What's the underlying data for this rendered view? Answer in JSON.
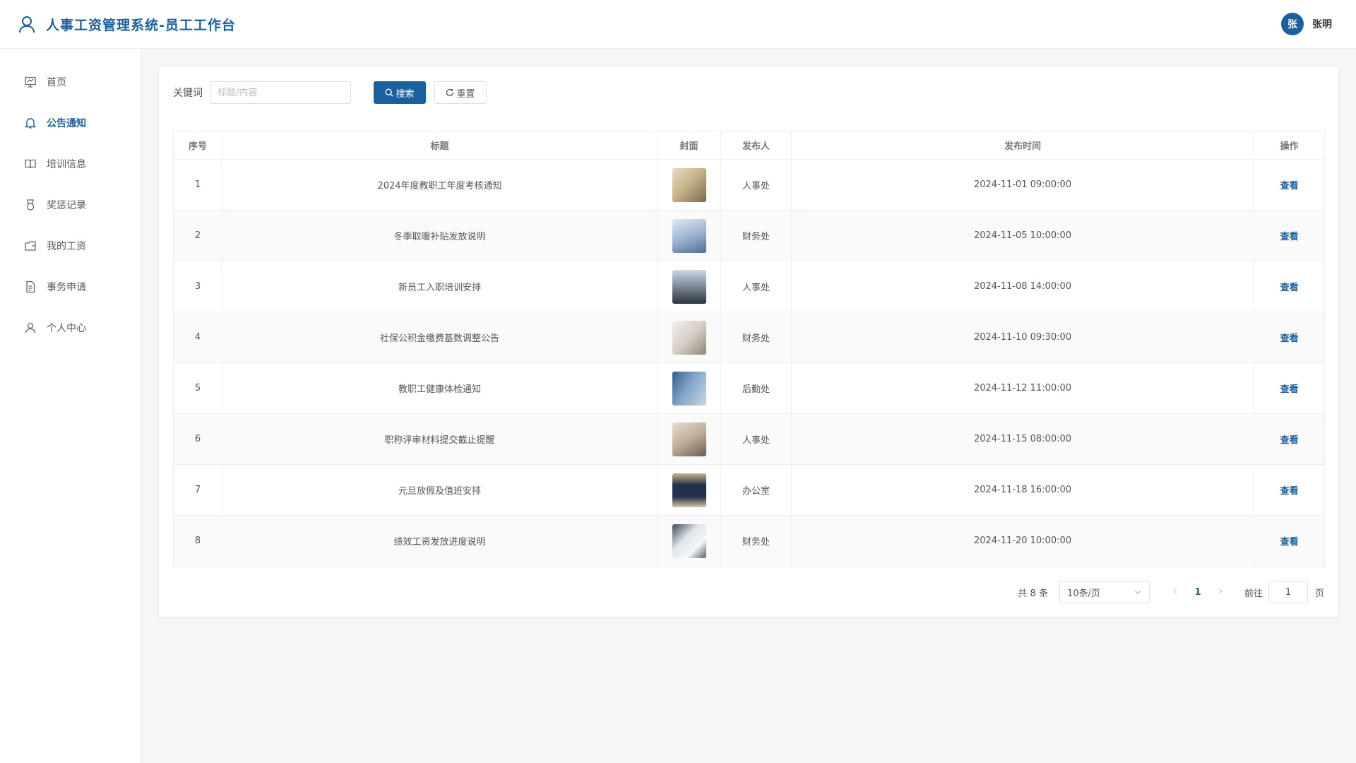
{
  "header": {
    "title": "人事工资管理系统-员工工作台",
    "avatar_initial": "张",
    "user_name": "张明"
  },
  "sidebar": {
    "items": [
      {
        "label": "首页",
        "icon": "presentation-icon"
      },
      {
        "label": "公告通知",
        "icon": "bell-icon",
        "active": true
      },
      {
        "label": "培训信息",
        "icon": "book-icon"
      },
      {
        "label": "奖惩记录",
        "icon": "medal-icon"
      },
      {
        "label": "我的工资",
        "icon": "wallet-icon"
      },
      {
        "label": "事务申请",
        "icon": "document-icon"
      },
      {
        "label": "个人中心",
        "icon": "user-icon"
      }
    ]
  },
  "search": {
    "label": "关键词",
    "placeholder": "标题/内容",
    "value": "",
    "search_label": "搜索",
    "reset_label": "重置"
  },
  "table": {
    "headers": [
      "序号",
      "标题",
      "封面",
      "发布人",
      "发布时间",
      "操作"
    ],
    "action_label": "查看",
    "rows": [
      {
        "no": "1",
        "title": "2024年度教职工年度考核通知",
        "publisher": "人事处",
        "time": "2024-11-01 09:00:00"
      },
      {
        "no": "2",
        "title": "冬季取暖补贴发放说明",
        "publisher": "财务处",
        "time": "2024-11-05 10:00:00"
      },
      {
        "no": "3",
        "title": "新员工入职培训安排",
        "publisher": "人事处",
        "time": "2024-11-08 14:00:00"
      },
      {
        "no": "4",
        "title": "社保公积金缴费基数调整公告",
        "publisher": "财务处",
        "time": "2024-11-10 09:30:00"
      },
      {
        "no": "5",
        "title": "教职工健康体检通知",
        "publisher": "后勤处",
        "time": "2024-11-12 11:00:00"
      },
      {
        "no": "6",
        "title": "职称评审材料提交截止提醒",
        "publisher": "人事处",
        "time": "2024-11-15 08:00:00"
      },
      {
        "no": "7",
        "title": "元旦放假及值班安排",
        "publisher": "办公室",
        "time": "2024-11-18 16:00:00"
      },
      {
        "no": "8",
        "title": "绩效工资发放进度说明",
        "publisher": "财务处",
        "time": "2024-11-20 10:00:00"
      }
    ]
  },
  "pagination": {
    "total": "共 8 条",
    "page_size": "10条/页",
    "current_page": "1",
    "goto_label": "前往",
    "goto_value": "1",
    "page_suffix": "页"
  },
  "colors": {
    "primary": "#1a5f9e"
  }
}
